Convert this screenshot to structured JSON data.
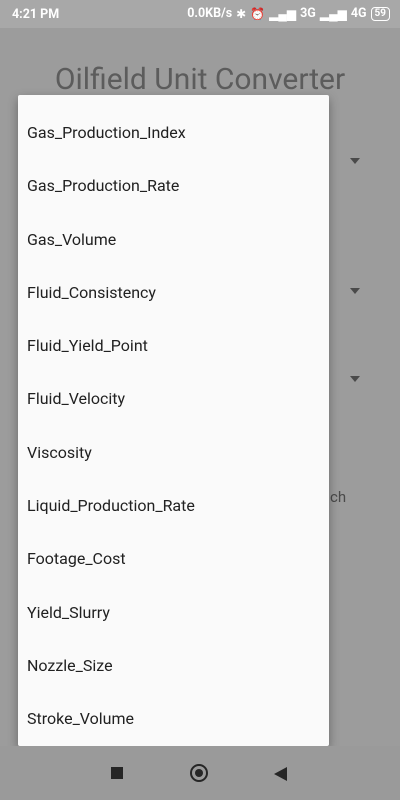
{
  "status_bar": {
    "time": "4:21 PM",
    "net_speed": "0.0KB/s",
    "network_3g": "3G",
    "network_4g": "4G",
    "battery": "59",
    "icons": [
      "bluetooth-icon",
      "alarm-icon",
      "signal-icon",
      "signal-icon"
    ]
  },
  "app": {
    "title": "Oilfield Unit Converter",
    "background_fragment": "ch"
  },
  "dropdown": {
    "items": [
      "Gas_Production_Index",
      "Gas_Production_Rate",
      "Gas_Volume",
      "Fluid_Consistency",
      "Fluid_Yield_Point",
      "Fluid_Velocity",
      "Viscosity",
      "Liquid_Production_Rate",
      "Footage_Cost",
      "Yield_Slurry",
      "Nozzle_Size",
      "Stroke_Volume"
    ]
  },
  "nav_bar": {
    "icons": [
      "recents-square-icon",
      "home-circle-icon",
      "back-triangle-icon"
    ]
  },
  "colors": {
    "scrim": "#9a9a9a",
    "popup_background": "#fafafa",
    "item_text": "#212121"
  }
}
